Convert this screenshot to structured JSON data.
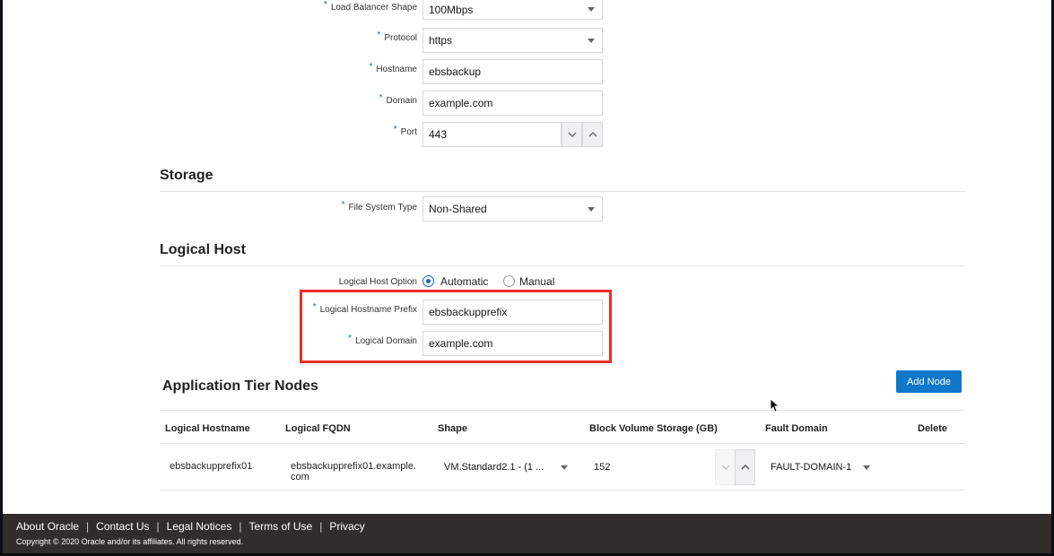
{
  "load_balancer": {
    "shape_label": "Load Balancer Shape",
    "shape_value": "100Mbps",
    "protocol_label": "Protocol",
    "protocol_value": "https",
    "hostname_label": "Hostname",
    "hostname_value": "ebsbackup",
    "domain_label": "Domain",
    "domain_value": "example.com",
    "port_label": "Port",
    "port_value": "443"
  },
  "storage": {
    "title": "Storage",
    "fs_type_label": "File System Type",
    "fs_type_value": "Non-Shared"
  },
  "logical_host": {
    "title": "Logical Host",
    "option_label": "Logical Host Option",
    "option_automatic": "Automatic",
    "option_manual": "Manual",
    "selected": "Automatic",
    "prefix_label": "Logical Hostname Prefix",
    "prefix_value": "ebsbackupprefix",
    "domain_label": "Logical Domain",
    "domain_value": "example.com"
  },
  "app_tier": {
    "title": "Application Tier Nodes",
    "add_node_label": "Add Node",
    "columns": [
      "Logical Hostname",
      "Logical FQDN",
      "Shape",
      "Block Volume Storage (GB)",
      "Fault Domain",
      "Delete"
    ],
    "rows": [
      {
        "hostname": "ebsbackupprefix01",
        "fqdn_line1": "ebsbackupprefix01.example.",
        "fqdn_line2": "com",
        "shape": "VM.Standard2.1 - (1 ...",
        "storage": "152",
        "fault_domain": "FAULT-DOMAIN-1"
      }
    ]
  },
  "footer": {
    "links": [
      "About Oracle",
      "Contact Us",
      "Legal Notices",
      "Terms of Use",
      "Privacy"
    ],
    "copyright": "Copyright © 2020 Oracle and/or its affiliates. All rights reserved."
  },
  "colors": {
    "accent": "#0f77c9",
    "required_marker": "#1a66b3",
    "highlight_border": "#e8302a",
    "footer_bg": "#312d2a"
  }
}
